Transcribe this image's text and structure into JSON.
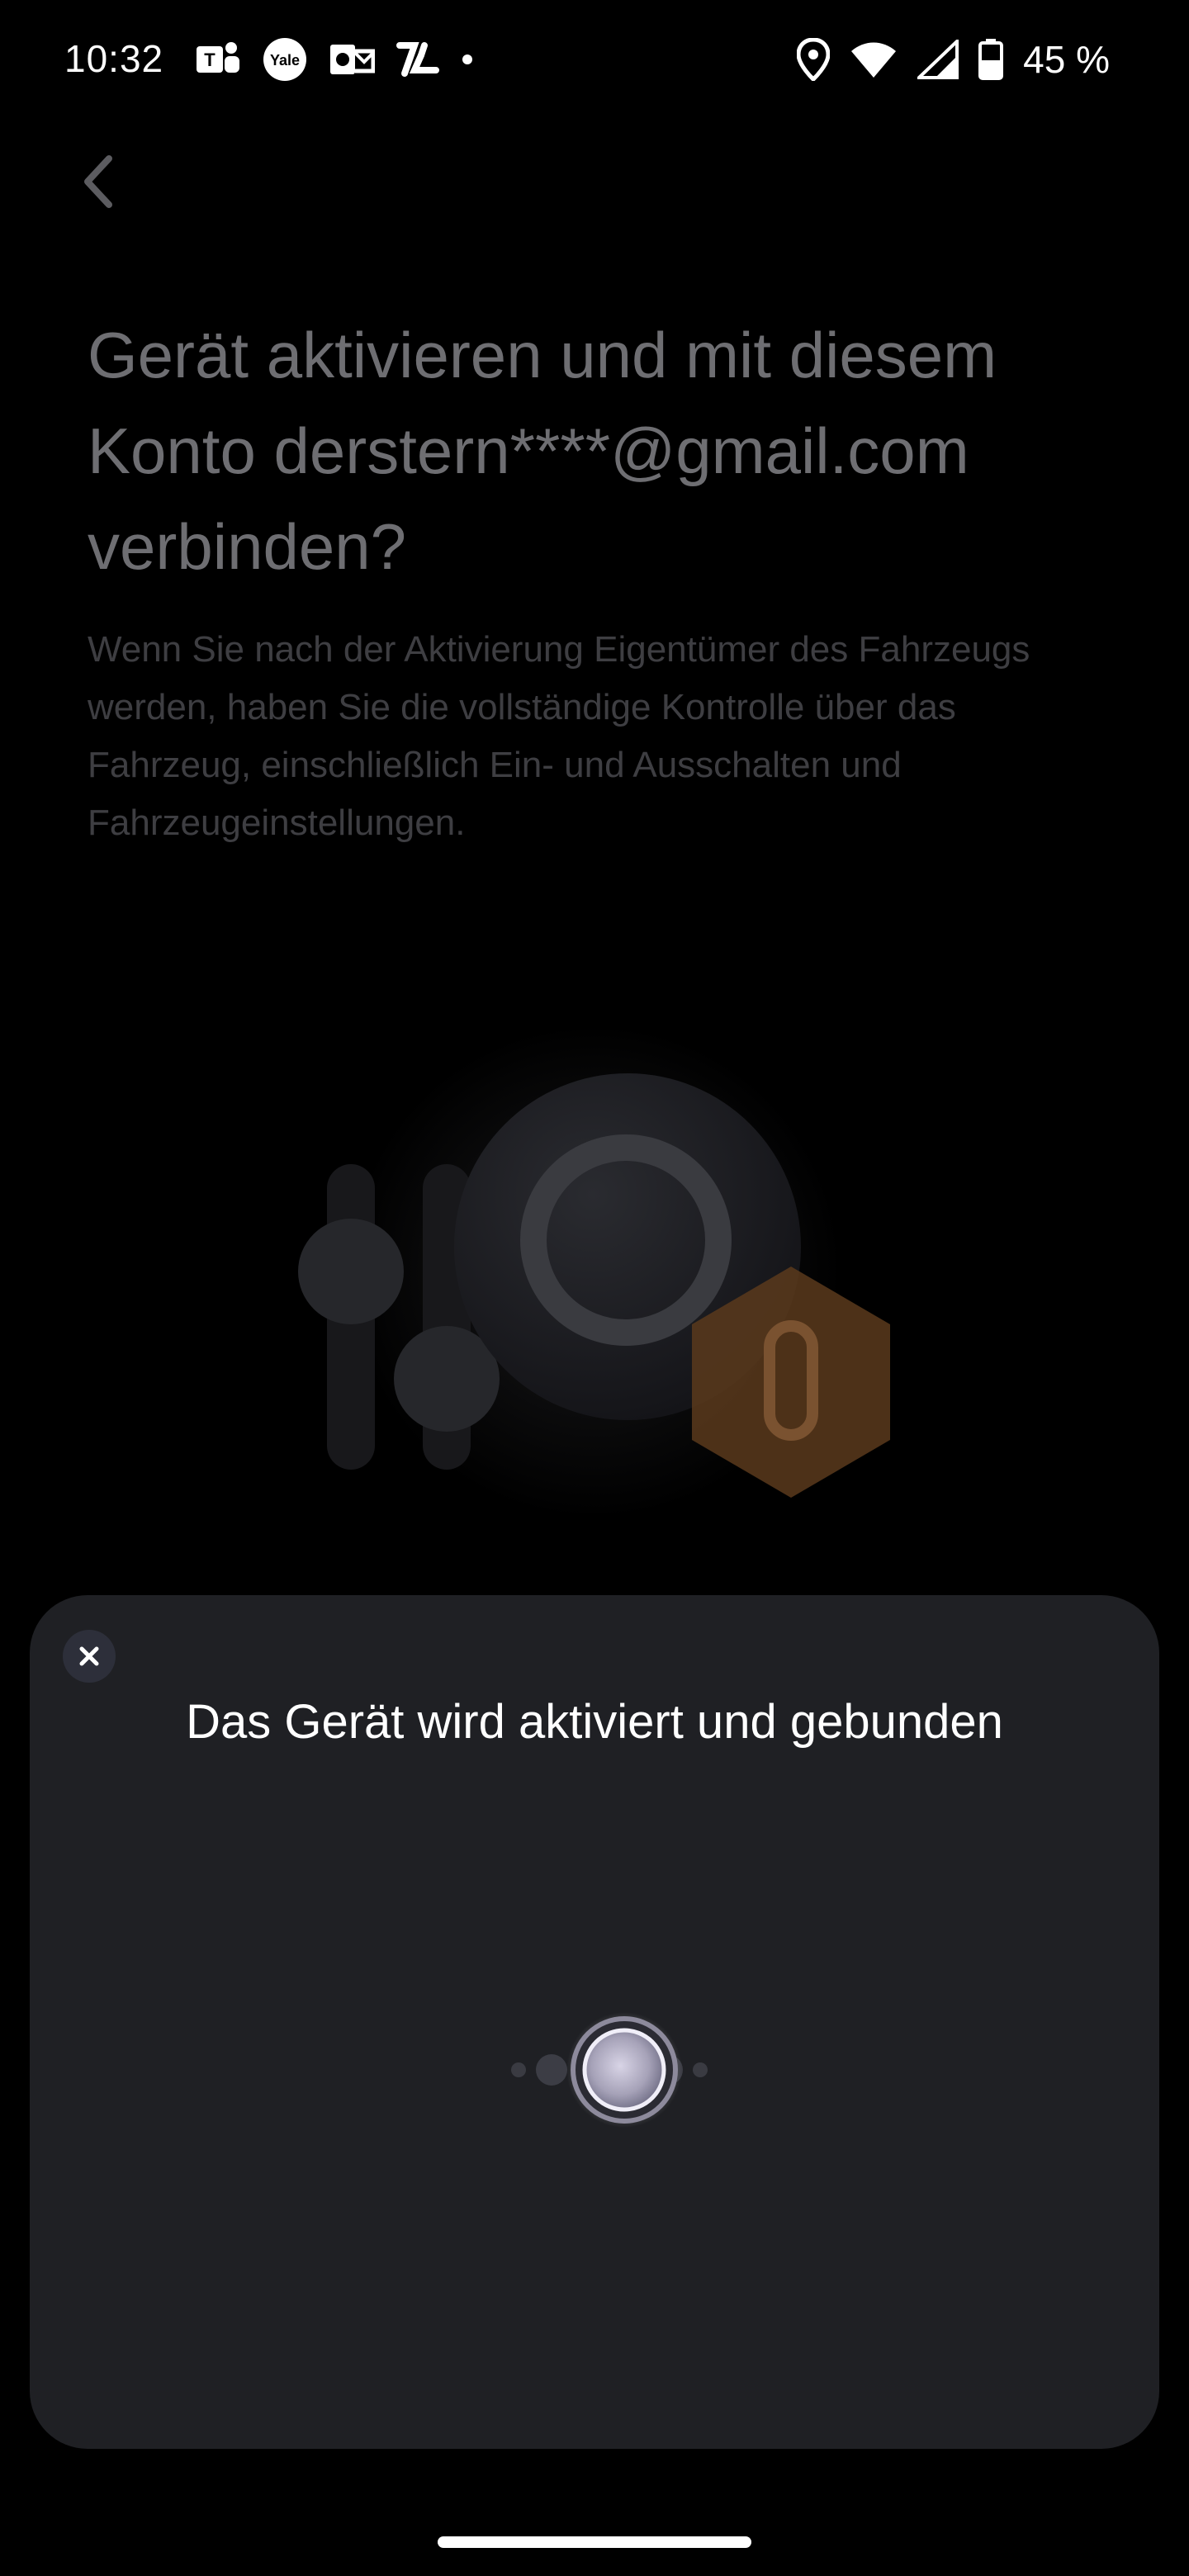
{
  "status_bar": {
    "time": "10:32",
    "battery": "45 %",
    "left_icons": [
      "teams-icon",
      "yale-icon",
      "outlook-icon",
      "delivery-app-icon",
      "notification-dot"
    ],
    "right_icons": [
      "location-icon",
      "wifi-icon",
      "signal-icon",
      "battery-icon"
    ]
  },
  "page": {
    "back_icon": "chevron-left-icon",
    "title_line1": "Gerät aktivieren und mit diesem",
    "title_line2": "Konto derstern****@gmail.com",
    "title_line3": "verbinden?",
    "description": "Wenn Sie nach der Aktivierung Eigentümer des Fahrzeugs werden, haben Sie die vollständige Kontrolle über das Fahrzeug, einschließlich Ein- und Ausschalten und Fahrzeugeinstellungen."
  },
  "sheet": {
    "close_icon": "close-icon",
    "title": "Das Gerät wird aktiviert und gebunden"
  },
  "colors": {
    "sheet_bg": "#1f2024",
    "accent_orange": "#8a5a2e"
  }
}
